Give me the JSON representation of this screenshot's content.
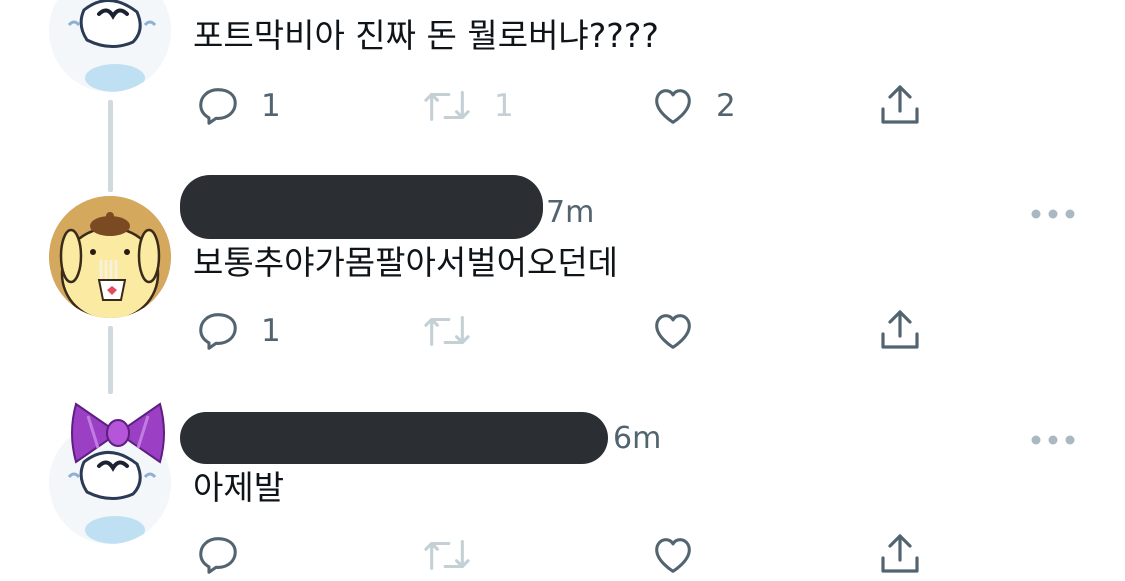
{
  "colors": {
    "text": "#0f1419",
    "secondary": "#536471",
    "retweet_disabled": "#c4cfd6",
    "thread_line": "#cfd9de",
    "redaction": "#2b2f33"
  },
  "tweets": [
    {
      "text": "포트막비아 진짜 돈 뭘로버냐????",
      "reply_count": "1",
      "retweet_count": "1",
      "like_count": "2",
      "icons": [
        "reply-icon",
        "retweet-icon",
        "like-icon",
        "share-icon"
      ]
    },
    {
      "time": "7m",
      "text": "보통추야가몸팔아서벌어오던데",
      "reply_count": "1",
      "retweet_count": "",
      "like_count": "",
      "icons": [
        "more-icon",
        "reply-icon",
        "retweet-icon",
        "like-icon",
        "share-icon"
      ]
    },
    {
      "time": "6m",
      "text": "아제발",
      "reply_count": "",
      "retweet_count": "",
      "like_count": "",
      "icons": [
        "more-icon",
        "reply-icon",
        "retweet-icon",
        "like-icon",
        "share-icon"
      ]
    }
  ]
}
